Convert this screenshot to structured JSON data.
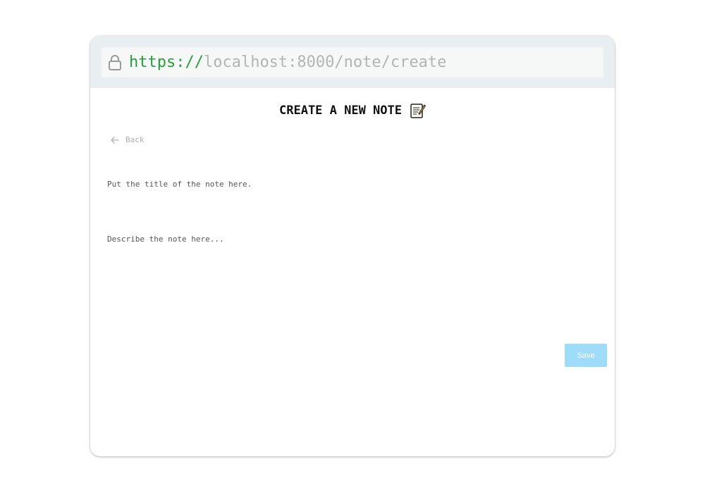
{
  "browser": {
    "url_scheme": "https://",
    "url_rest": "localhost:8000/note/create",
    "lock_icon": "lock-icon"
  },
  "page": {
    "title": "CREATE A NEW NOTE",
    "title_icon": "memo-icon",
    "back_label": "Back",
    "back_icon": "arrow-left-icon"
  },
  "form": {
    "title_placeholder": "Put the title of the note here.",
    "title_value": "",
    "description_placeholder": "Describe the note here...",
    "description_value": "",
    "save_label": "Save"
  },
  "colors": {
    "accent_green": "#2a9d3c",
    "save_button": "#9fdcfa",
    "address_bar_bg": "#e9eff1"
  }
}
